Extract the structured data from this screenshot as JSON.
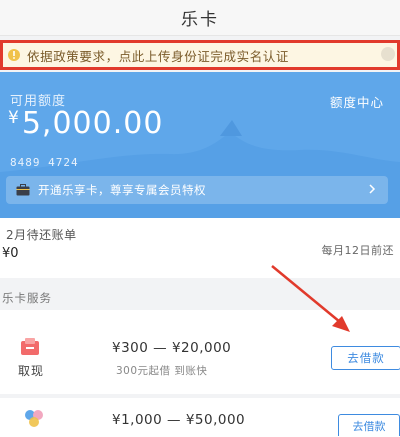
{
  "header": {
    "title": "乐卡"
  },
  "notice": {
    "text": "依据政策要求，点此上传身份证完成实名认证"
  },
  "card": {
    "quota_label": "可用额度",
    "center_label": "额度中心",
    "currency": "¥",
    "amount": "5,000.00",
    "card_number": "8489 4724",
    "member_text": "开通乐享卡，尊享专属会员特权"
  },
  "bill": {
    "title": "2月待还账单",
    "amount": "¥0",
    "due": "每月12日前还"
  },
  "services": {
    "title": "乐卡服务",
    "items": [
      {
        "icon": "cash-icon",
        "name": "取现",
        "range": "¥300 — ¥20,000",
        "sub": "300元起借  到账快",
        "button": "去借款"
      },
      {
        "icon": "dots-icon",
        "name": "",
        "range": "¥1,000 — ¥50,000",
        "sub": "",
        "button": "去借款"
      }
    ]
  },
  "colors": {
    "card_bg": "#5fa7ea",
    "notice_border": "#e13a2c",
    "accent": "#3e8be0"
  }
}
